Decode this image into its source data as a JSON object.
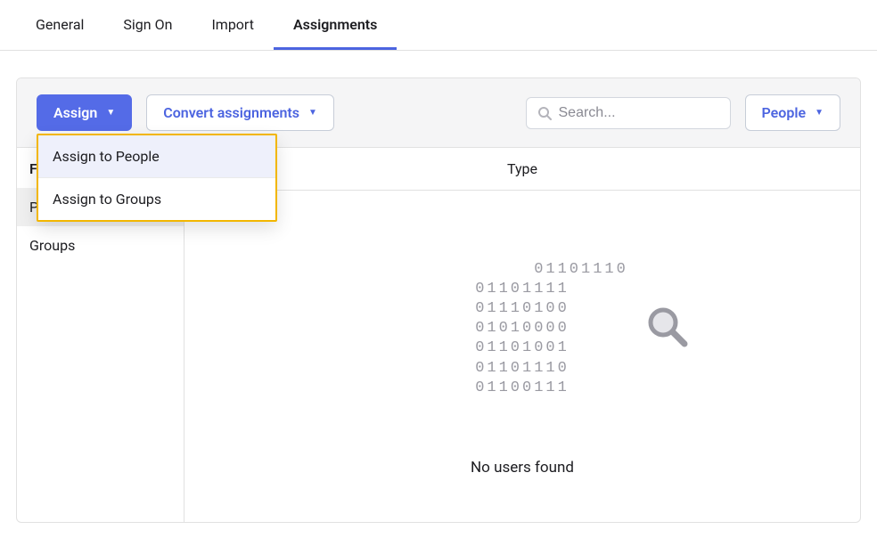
{
  "tabs": {
    "general": "General",
    "signon": "Sign On",
    "import": "Import",
    "assignments": "Assignments"
  },
  "toolbar": {
    "assign_label": "Assign",
    "convert_label": "Convert assignments",
    "people_label": "People",
    "search_placeholder": "Search..."
  },
  "dropdown": {
    "assign_people": "Assign to People",
    "assign_groups": "Assign to Groups"
  },
  "sidebar": {
    "filters_label": "Filters",
    "people": "People",
    "groups": "Groups"
  },
  "table": {
    "header_type": "Type"
  },
  "empty": {
    "binary": "01101110\n01101111\n01110100\n01010000\n01101001\n01101110\n01100111",
    "message": "No users found"
  }
}
